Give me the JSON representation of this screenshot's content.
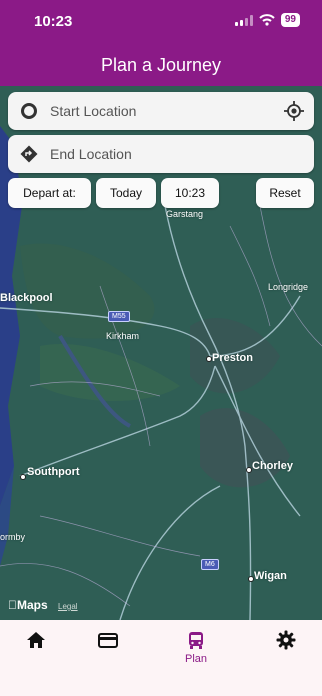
{
  "status": {
    "time": "10:23",
    "battery": "99"
  },
  "header": {
    "title": "Plan a Journey"
  },
  "search": {
    "start_label": "Start Location",
    "end_label": "End Location"
  },
  "options": {
    "depart_label": "Depart at:",
    "date_label": "Today",
    "time_value": "10:23",
    "reset_label": "Reset"
  },
  "map": {
    "attribution": "Maps",
    "legal": "Legal",
    "places": {
      "garstang": "Garstang",
      "blackpool": "Blackpool",
      "longridge": "Longridge",
      "kirkham": "Kirkham",
      "preston": "Preston",
      "southport": "Southport",
      "chorley": "Chorley",
      "ormby": "ormby",
      "wigan": "Wigan"
    },
    "roads": {
      "m55": "M55",
      "m6": "M6"
    }
  },
  "tabbar": {
    "plan_label": "Plan"
  },
  "colors": {
    "brand": "#8b1a87",
    "map_land": "#2f5e55",
    "sea": "#2a3f88"
  }
}
